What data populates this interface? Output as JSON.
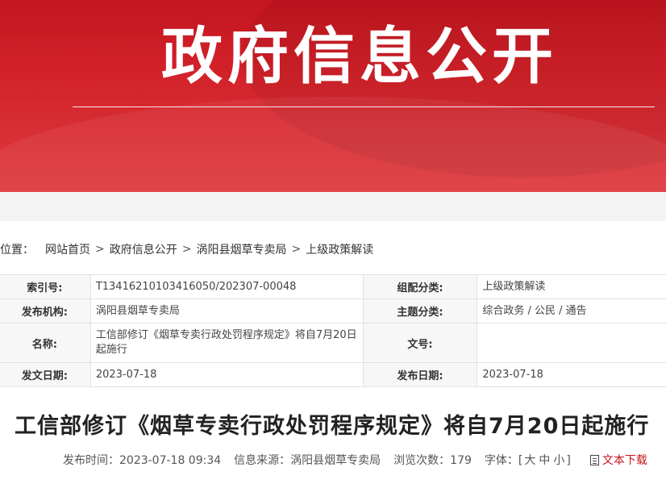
{
  "banner": {
    "title": "政府信息公开"
  },
  "breadcrumb": {
    "prefix": "位置：",
    "items": [
      "网站首页",
      "政府信息公开",
      "涡阳县烟草专卖局",
      "上级政策解读"
    ],
    "separator": ">"
  },
  "info": {
    "index_label": "索引号:",
    "index_value": "T13416210103416050/202307-00048",
    "category_label": "组配分类:",
    "category_value": "上级政策解读",
    "publisher_label": "发布机构:",
    "publisher_value": "涡阳县烟草专卖局",
    "topic_label": "主题分类:",
    "topic_value": "综合政务 / 公民 / 通告",
    "name_label": "名称:",
    "name_value": "工信部修订《烟草专卖行政处罚程序规定》将自7月20日起施行",
    "docno_label": "文号:",
    "docno_value": "",
    "issue_date_label": "发文日期:",
    "issue_date_value": "2023-07-18",
    "pub_date_label": "发布日期:",
    "pub_date_value": "2023-07-18"
  },
  "article": {
    "title": "工信部修订《烟草专卖行政处罚程序规定》将自7月20日起施行"
  },
  "meta": {
    "time_label": "发布时间：",
    "time_value": "2023-07-18 09:34",
    "source_label": "信息来源：",
    "source_value": "涡阳县烟草专卖局",
    "views_label": "浏览次数：",
    "views_value": "179",
    "font_label": "字体：",
    "font_open": "[",
    "font_large": "大",
    "font_medium": "中",
    "font_small": "小",
    "font_close": "]",
    "download_label": "文本下载"
  },
  "colors": {
    "brand_red": "#c4161f"
  }
}
